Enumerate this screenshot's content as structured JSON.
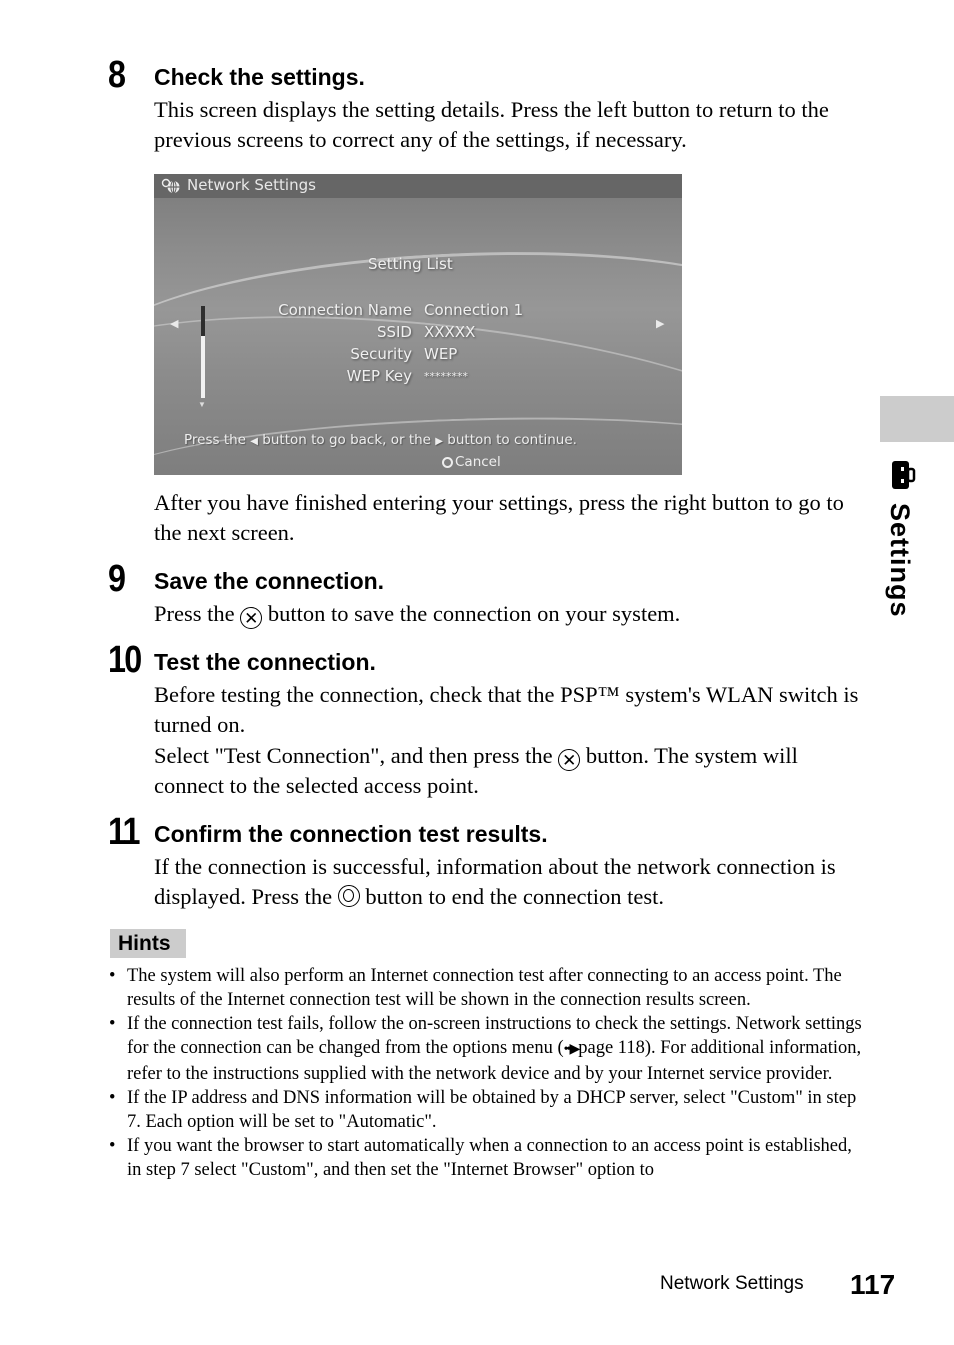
{
  "steps": [
    {
      "number": "8",
      "title": "Check the settings.",
      "text": "This screen displays the setting details. Press the left button to return to the previous screens to correct any of the settings, if necessary.",
      "after_text": "After you have finished entering your settings, press the right button to go to the next screen."
    },
    {
      "number": "9",
      "title": "Save the connection.",
      "text_before_icon": "Press the",
      "icon": "cross-button-icon",
      "icon_glyph": "✕",
      "text_after_icon": "button to save the connection on your system."
    },
    {
      "number": "10",
      "title": "Test the connection.",
      "text1": "Before testing the connection, check that the PSP™ system's WLAN switch is turned on.",
      "text2_before_icon": "Select \"Test Connection\", and then press the",
      "icon": "cross-button-icon",
      "icon_glyph": "✕",
      "text2_after_icon": "button. The system will connect to the selected access point."
    },
    {
      "number": "11",
      "title": "Confirm the connection test results.",
      "text_before_icon": "If the connection is successful, information about the network connection is displayed. Press the",
      "icon": "circle-button-icon",
      "text_after_icon": "button to end the connection test."
    }
  ],
  "screenshot": {
    "header_title": "Network Settings",
    "header_icon": "network-globe-icon",
    "section_title": "Setting List",
    "rows": [
      {
        "label": "Connection Name",
        "value": "Connection 1"
      },
      {
        "label": "SSID",
        "value": "XXXXX"
      },
      {
        "label": "Security",
        "value": "WEP"
      },
      {
        "label": "WEP Key",
        "value": "********"
      }
    ],
    "left_arrow": "◀",
    "right_arrow": "▶",
    "hint_part1": "Press the",
    "hint_left_glyph": "◀",
    "hint_part2": "button to go back, or the",
    "hint_right_glyph": "▶",
    "hint_part3": "button to continue.",
    "cancel_label": "Cancel"
  },
  "hints": {
    "label": "Hints",
    "items": [
      "The system will also perform an Internet connection test after connecting to an access point. The results of the Internet connection test will be shown in the connection results screen.",
      {
        "before_ref": "If the connection test fails, follow the on-screen instructions to check the settings. Network settings for the connection can be changed from the options menu (",
        "ref_glyph": "••▶",
        "after_ref": "page 118). For additional information, refer to the instructions supplied with the network device and by your Internet service provider."
      },
      "If the IP address and DNS information will be obtained by a DHCP server, select \"Custom\" in step 7. Each option will be set to \"Automatic\".",
      "If you want the browser to start automatically when a connection to an access point is established, in step 7 select \"Custom\", and then set the \"Internet Browser\" option to"
    ]
  },
  "side_tab": {
    "label": "Settings",
    "icon": "toolbox-icon"
  },
  "footer": {
    "section": "Network Settings",
    "page": "117"
  }
}
